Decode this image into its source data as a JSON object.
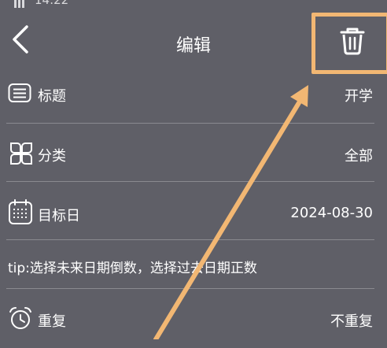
{
  "status_bar": {
    "time": "14:22"
  },
  "header": {
    "title": "编辑"
  },
  "rows": [
    {
      "label": "标题",
      "value": "开学",
      "icon": "list-icon"
    },
    {
      "label": "分类",
      "value": "全部",
      "icon": "category-grid-icon"
    },
    {
      "label": "目标日",
      "value": "2024-08-30",
      "icon": "calendar-icon"
    },
    {
      "label": "重复",
      "value": "不重复",
      "icon": "alarm-clock-icon"
    }
  ],
  "tip": "tip:选择未来日期倒数，选择过去日期正数",
  "colors": {
    "background": "#5f5f67",
    "divider": "#8a8a90",
    "highlight": "#f2b773",
    "text": "#ffffff"
  }
}
